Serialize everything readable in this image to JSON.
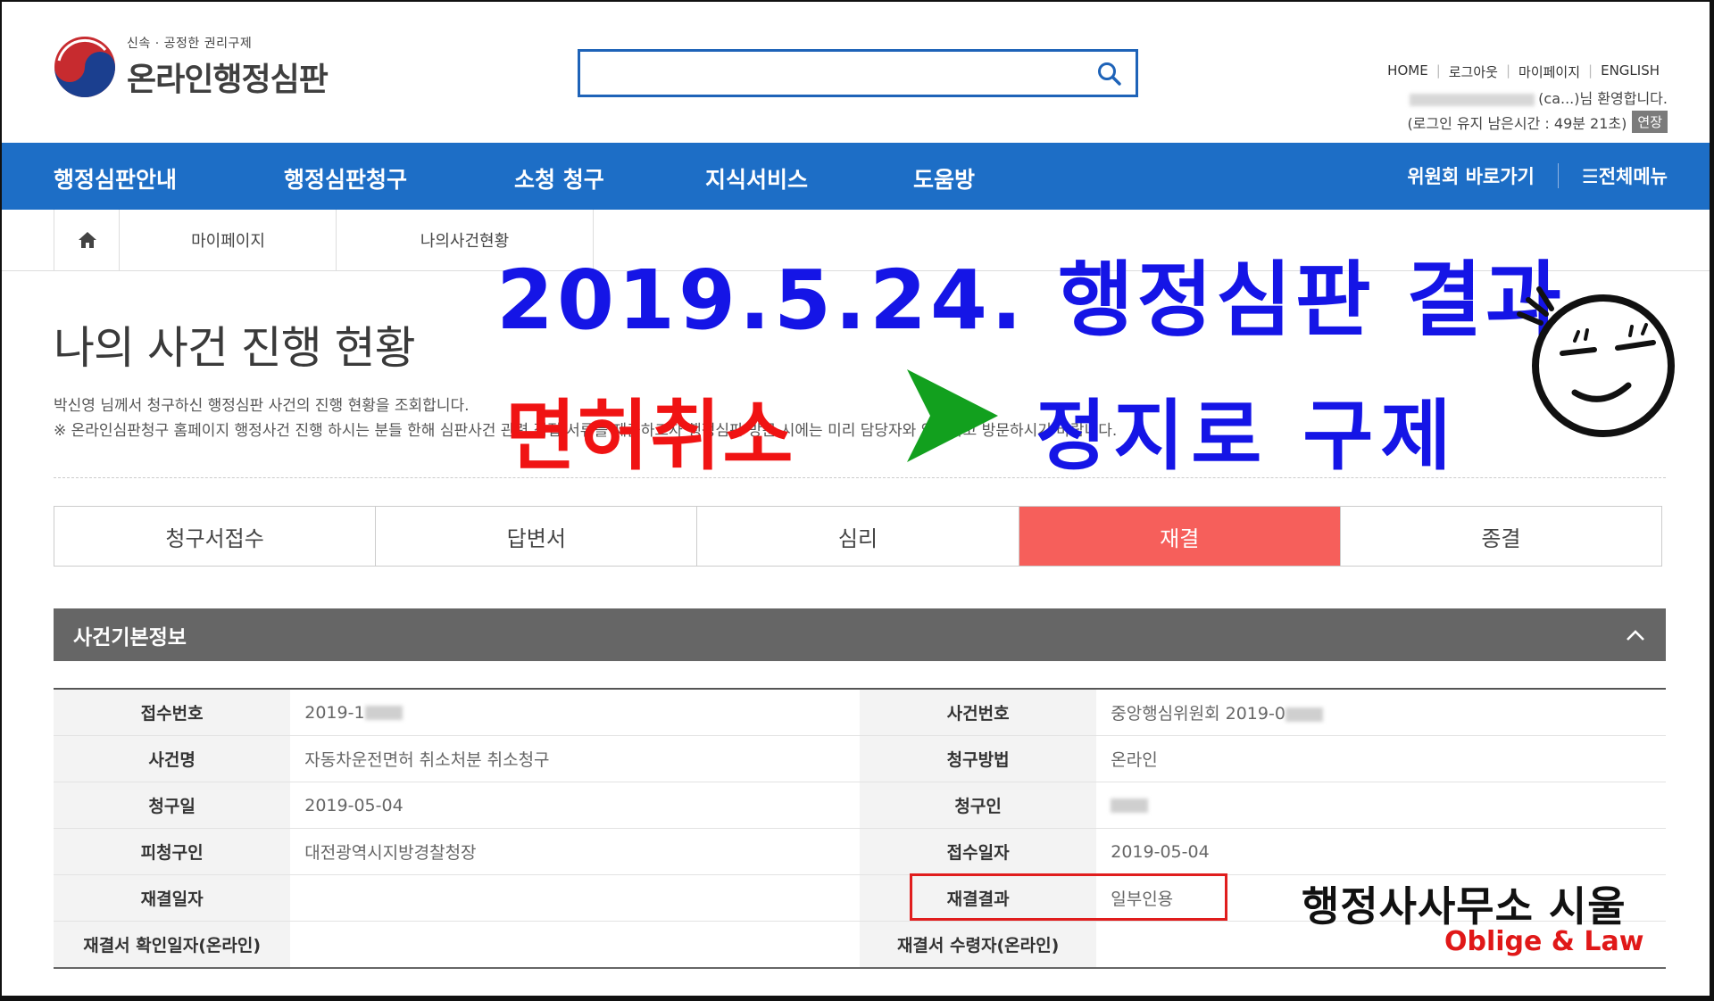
{
  "header": {
    "logo_tagline": "신속 · 공정한 권리구제",
    "logo_name": "온라인행정심판",
    "search_placeholder": "",
    "util_links": [
      "HOME",
      "로그아웃",
      "마이페이지",
      "ENGLISH"
    ],
    "welcome_text": "(ca...)님 환영합니다.",
    "session_text": "(로그인 유지 남은시간 : 49분 21초)",
    "extend_label": "연장"
  },
  "nav": {
    "items": [
      "행정심판안내",
      "행정심판청구",
      "소청 청구",
      "지식서비스",
      "도움방"
    ],
    "committee_link": "위원회 바로가기",
    "all_menu": "☰전체메뉴"
  },
  "breadcrumb": {
    "items": [
      "마이페이지",
      "나의사건현황"
    ]
  },
  "page": {
    "title": "나의 사건 진행 현황",
    "desc1": "박신영 님께서 청구하신 행정심판 사건의 진행 현황을 조회합니다.",
    "desc2": "※ 온라인심판청구 홈페이지 행정사건 진행 하시는 분들 한해 심판사건 관련 직접 서류를 제출하고자 행정심판 방문 시에는 미리 담당자와 약속하고 방문하시기 바랍니다."
  },
  "steps": [
    {
      "label": "청구서접수",
      "active": false
    },
    {
      "label": "답변서",
      "active": false
    },
    {
      "label": "심리",
      "active": false
    },
    {
      "label": "재결",
      "active": true
    },
    {
      "label": "종결",
      "active": false
    }
  ],
  "section": {
    "title": "사건기본정보"
  },
  "info_rows": [
    {
      "k1": "접수번호",
      "v1": "2019-1",
      "k2": "사건번호",
      "v2": "중앙행심위원회 2019-0"
    },
    {
      "k1": "사건명",
      "v1": "자동차운전면허 취소처분 취소청구",
      "k2": "청구방법",
      "v2": "온라인"
    },
    {
      "k1": "청구일",
      "v1": "2019-05-04",
      "k2": "청구인",
      "v2": ""
    },
    {
      "k1": "피청구인",
      "v1": "대전광역시지방경찰청장",
      "k2": "접수일자",
      "v2": "2019-05-04"
    },
    {
      "k1": "재결일자",
      "v1": "",
      "k2": "재결결과",
      "v2": "일부인용"
    },
    {
      "k1": "재결서 확인일자(온라인)",
      "v1": "",
      "k2": "재결서 수령자(온라인)",
      "v2": ""
    }
  ],
  "overlay": {
    "headline": "2019.5.24. 행정심판 결과",
    "before": "면허취소",
    "after": "정지로 구제",
    "office_name": "행정사사무소 시울",
    "office_sub": "Oblige & Law"
  },
  "colors": {
    "nav_blue": "#1d6ec6",
    "active_step": "#f65f5b",
    "section_head": "#666666",
    "overlay_blue": "#1515e6",
    "overlay_red": "#f01313",
    "arrow_green": "#12a01e"
  }
}
